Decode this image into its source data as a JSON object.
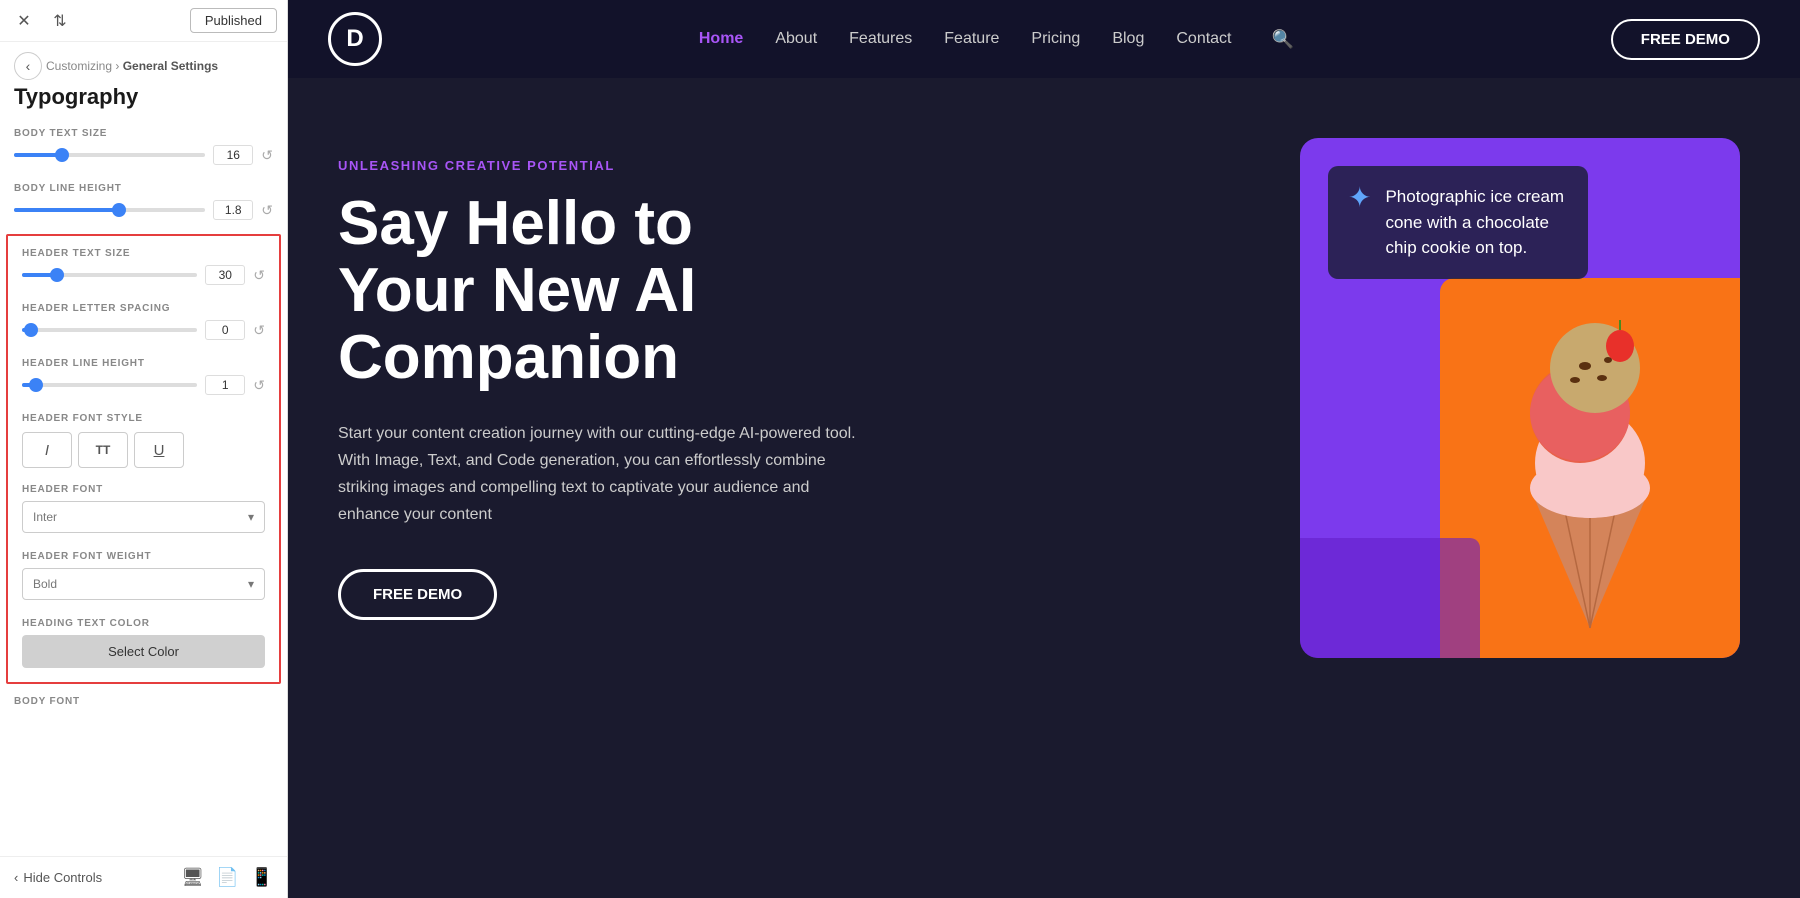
{
  "topbar": {
    "published_label": "Published",
    "close_icon": "✕",
    "swap_icon": "⇅"
  },
  "panel": {
    "back_icon": "‹",
    "breadcrumb_parent": "Customizing",
    "breadcrumb_arrow": "›",
    "breadcrumb_child": "General Settings",
    "title": "Typography",
    "body_text_size_label": "BODY TEXT SIZE",
    "body_text_size_value": "16",
    "body_text_size_percent": 25,
    "body_line_height_label": "BODY LINE HEIGHT",
    "body_line_height_value": "1.8",
    "body_line_height_percent": 55,
    "header_text_size_label": "HEADER TEXT SIZE",
    "header_text_size_value": "30",
    "header_text_size_percent": 20,
    "header_letter_spacing_label": "HEADER LETTER SPACING",
    "header_letter_spacing_value": "0",
    "header_letter_spacing_percent": 5,
    "header_line_height_label": "HEADER LINE HEIGHT",
    "header_line_height_value": "1",
    "header_line_height_percent": 8,
    "header_font_style_label": "HEADER FONT STYLE",
    "style_italic": "I",
    "style_caps": "TT",
    "style_underline": "U",
    "header_font_label": "HEADER FONT",
    "header_font_value": "Inter",
    "header_font_weight_label": "HEADER FONT WEIGHT",
    "header_font_weight_value": "Bold",
    "heading_text_color_label": "HEADING TEXT COLOR",
    "select_color_label": "Select Color",
    "body_font_label": "BODY FONT",
    "hide_controls_label": "Hide Controls"
  },
  "site": {
    "logo_letter": "D",
    "nav_links": [
      "Home",
      "About",
      "Features",
      "Feature",
      "Pricing",
      "Blog",
      "Contact"
    ],
    "nav_active": "Home",
    "free_demo_btn": "FREE DEMO",
    "hero_tag": "UNLEASHING CREATIVE POTENTIAL",
    "hero_heading_line1": "Say Hello to",
    "hero_heading_line2": "Your New AI",
    "hero_heading_line3": "Companion",
    "hero_desc": "Start your content creation journey with our cutting-edge AI-powered tool. With Image, Text, and Code generation, you can effortlessly combine striking images and compelling text to captivate your audience and enhance your content",
    "hero_cta": "FREE DEMO",
    "ai_tooltip_text": "Photographic ice cream cone with a chocolate chip cookie on top."
  }
}
